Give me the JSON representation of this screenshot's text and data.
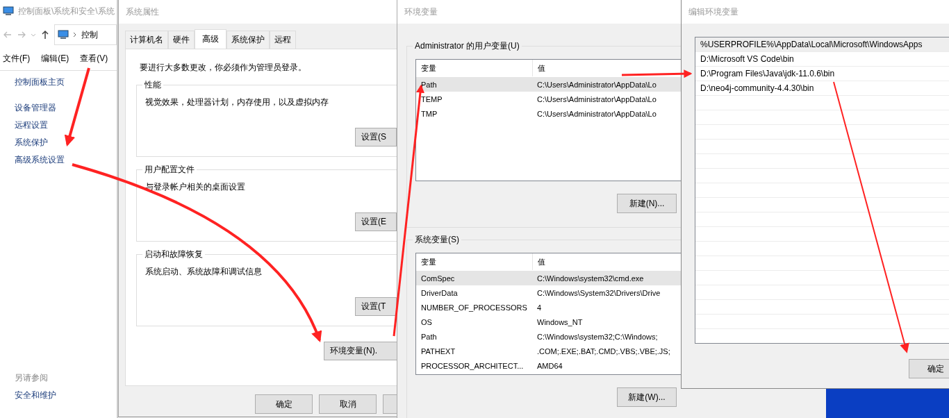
{
  "explorer": {
    "title": "控制面板\\系统和安全\\系统",
    "address": "控制",
    "menu": [
      "文件(F)",
      "编辑(E)",
      "查看(V)"
    ],
    "sidebar": {
      "home": "控制面板主页",
      "items": [
        "设备管理器",
        "远程设置",
        "系统保护",
        "高级系统设置"
      ]
    },
    "see_also": {
      "heading": "另请参阅",
      "items": [
        "安全和维护"
      ]
    }
  },
  "system_properties": {
    "title": "系统属性",
    "tabs": [
      {
        "label": "计算机名",
        "selected": false
      },
      {
        "label": "硬件",
        "selected": false
      },
      {
        "label": "高级",
        "selected": true
      },
      {
        "label": "系统保护",
        "selected": false
      },
      {
        "label": "远程",
        "selected": false
      }
    ],
    "notice": "要进行大多数更改，你必须作为管理员登录。",
    "groups": [
      {
        "title": "性能",
        "description": "视觉效果，处理器计划，内存使用，以及虚拟内存",
        "button": "设置(S"
      },
      {
        "title": "用户配置文件",
        "description": "与登录帐户相关的桌面设置",
        "button": "设置(E"
      },
      {
        "title": "启动和故障恢复",
        "description": "系统启动、系统故障和调试信息",
        "button": "设置(T"
      }
    ],
    "env_button": "环境变量(N).",
    "buttons": [
      "确定",
      "取消"
    ]
  },
  "environment_variables": {
    "title": "环境变量",
    "user_variables": {
      "title": "Administrator 的用户变量(U)",
      "columns": [
        "变量",
        "值"
      ],
      "rows": [
        {
          "name": "Path",
          "value": "C:\\Users\\Administrator\\AppData\\Lo",
          "selected": true
        },
        {
          "name": "TEMP",
          "value": "C:\\Users\\Administrator\\AppData\\Lo",
          "selected": false
        },
        {
          "name": "TMP",
          "value": "C:\\Users\\Administrator\\AppData\\Lo",
          "selected": false
        }
      ],
      "new_button": "新建(N)..."
    },
    "system_variables": {
      "title": "系统变量(S)",
      "columns": [
        "变量",
        "值"
      ],
      "rows": [
        {
          "name": "ComSpec",
          "value": "C:\\Windows\\system32\\cmd.exe",
          "selected": true
        },
        {
          "name": "DriverData",
          "value": "C:\\Windows\\System32\\Drivers\\Drive",
          "selected": false
        },
        {
          "name": "NUMBER_OF_PROCESSORS",
          "value": "4",
          "selected": false
        },
        {
          "name": "OS",
          "value": "Windows_NT",
          "selected": false
        },
        {
          "name": "Path",
          "value": "C:\\Windows\\system32;C:\\Windows;",
          "selected": false
        },
        {
          "name": "PATHEXT",
          "value": ".COM;.EXE;.BAT;.CMD;.VBS;.VBE;.JS;",
          "selected": false
        },
        {
          "name": "PROCESSOR_ARCHITECT...",
          "value": "AMD64",
          "selected": false
        }
      ],
      "new_button": "新建(W)..."
    }
  },
  "edit_variable": {
    "title": "编辑环境变量",
    "entries": [
      {
        "text": "%USERPROFILE%\\AppData\\Local\\Microsoft\\WindowsApps",
        "selected": true
      },
      {
        "text": "D:\\Microsoft VS Code\\bin",
        "selected": false
      },
      {
        "text": "D:\\Program Files\\Java\\jdk-11.0.6\\bin",
        "selected": false
      },
      {
        "text": "D:\\neo4j-community-4.4.30\\bin",
        "selected": false
      }
    ],
    "ok_button": "确定"
  }
}
